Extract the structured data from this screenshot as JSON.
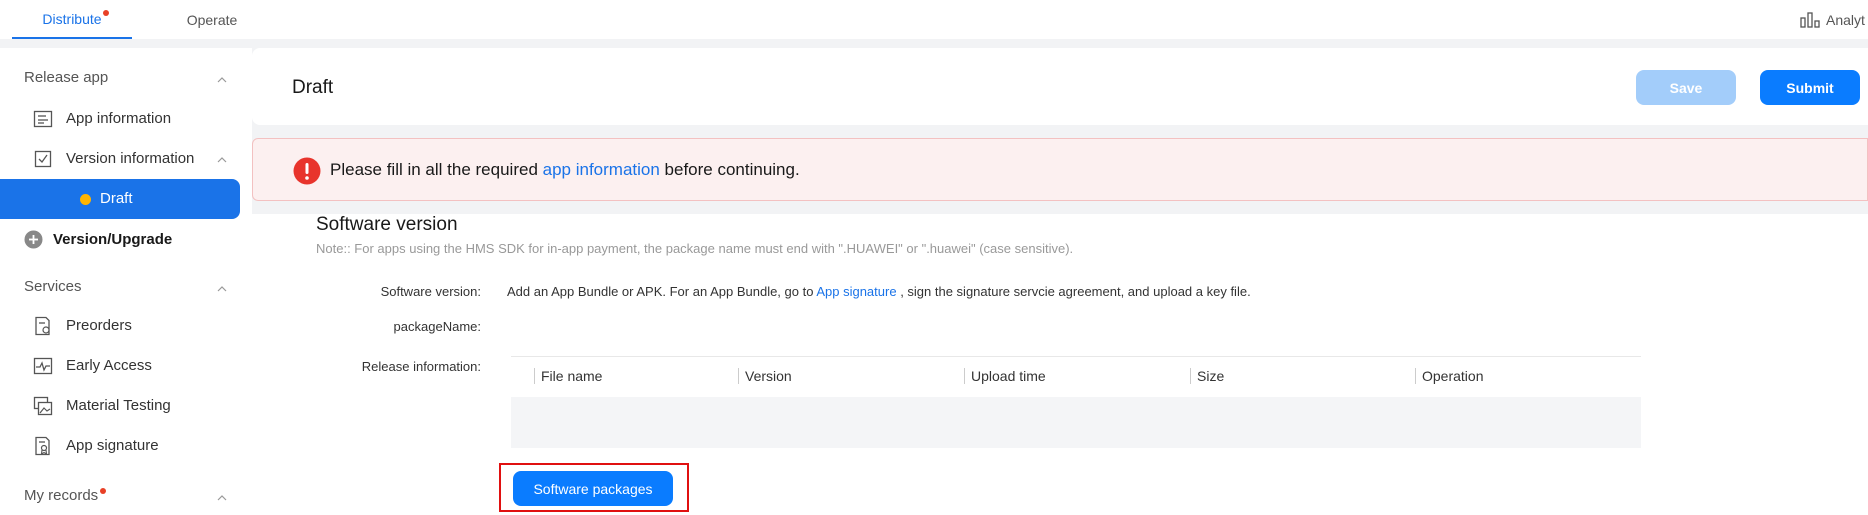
{
  "topbar": {
    "tabs": [
      {
        "label": "Distribute",
        "active": true,
        "has_dot": true
      },
      {
        "label": "Operate",
        "active": false,
        "has_dot": false
      }
    ],
    "analytics_label": "Analyt",
    "analytics_icon": "bar-chart-icon"
  },
  "sidebar": {
    "release_app": "Release app",
    "app_information": "App information",
    "version_information": "Version information",
    "draft": "Draft",
    "version_upgrade": "Version/Upgrade",
    "services": "Services",
    "preorders": "Preorders",
    "early_access": "Early Access",
    "material_testing": "Material Testing",
    "app_signature": "App signature",
    "my_records": "My records"
  },
  "header": {
    "title": "Draft",
    "save_label": "Save",
    "submit_label": "Submit"
  },
  "alert": {
    "text_before": "Please fill in all the required ",
    "link": "app information",
    "text_after": " before continuing."
  },
  "software": {
    "title": "Software version",
    "note": "Note:: For apps using the HMS SDK for in-app payment, the package name must end with \".HUAWEI\" or \".huawei\" (case sensitive).",
    "version_label": "Software version:",
    "version_text_before": "Add an App Bundle or APK. For an App Bundle, go to ",
    "version_link": "App signature",
    "version_text_after": " , sign the signature servcie agreement, and upload a key file.",
    "package_label": "packageName:",
    "release_label": "Release information:",
    "columns": [
      "File name",
      "Version",
      "Upload time",
      "Size",
      "Operation"
    ],
    "packages_button": "Software packages"
  },
  "colors": {
    "accent": "#0a7cff",
    "accent_disabled": "#a3cdfa",
    "alert_bg": "#fcf0f0",
    "error_red": "#e8342c",
    "draft_dot": "#ffb400"
  }
}
